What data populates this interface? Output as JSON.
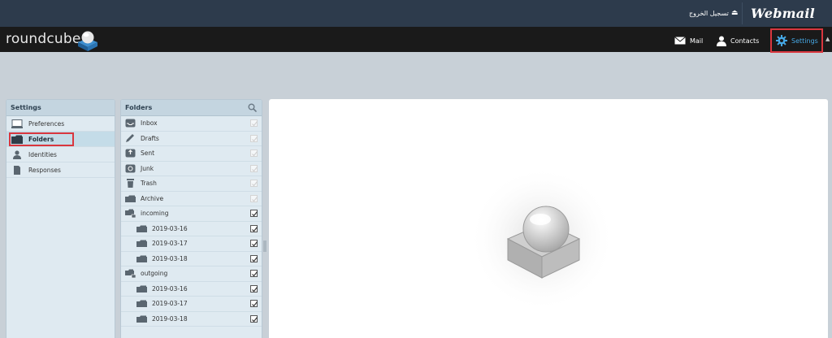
{
  "topbar": {
    "logout_label": "تسجيل الخروج",
    "brand": "Webmail"
  },
  "header": {
    "logo_text": "roundcube",
    "nav": {
      "mail": "Mail",
      "contacts": "Contacts",
      "settings": "Settings"
    }
  },
  "settings_panel": {
    "title": "Settings",
    "items": [
      {
        "label": "Preferences",
        "icon": "monitor-icon"
      },
      {
        "label": "Folders",
        "icon": "folder-icon",
        "selected": true
      },
      {
        "label": "Identities",
        "icon": "person-icon"
      },
      {
        "label": "Responses",
        "icon": "document-icon"
      }
    ]
  },
  "folders_panel": {
    "title": "Folders",
    "folders": [
      {
        "name": "Inbox",
        "icon": "inbox-icon",
        "checked": false
      },
      {
        "name": "Drafts",
        "icon": "pencil-icon",
        "checked": false
      },
      {
        "name": "Sent",
        "icon": "sent-icon",
        "checked": false
      },
      {
        "name": "Junk",
        "icon": "junk-icon",
        "checked": false
      },
      {
        "name": "Trash",
        "icon": "trash-icon",
        "checked": false
      },
      {
        "name": "Archive",
        "icon": "folder-icon",
        "checked": false
      },
      {
        "name": "incoming",
        "icon": "folder-tree-icon",
        "checked": true
      },
      {
        "name": "2019-03-16",
        "icon": "folder-icon",
        "checked": true,
        "sub": true
      },
      {
        "name": "2019-03-17",
        "icon": "folder-icon",
        "checked": true,
        "sub": true
      },
      {
        "name": "2019-03-18",
        "icon": "folder-icon",
        "checked": true,
        "sub": true
      },
      {
        "name": "outgoing",
        "icon": "folder-tree-icon",
        "checked": true
      },
      {
        "name": "2019-03-16",
        "icon": "folder-icon",
        "checked": true,
        "sub": true
      },
      {
        "name": "2019-03-17",
        "icon": "folder-icon",
        "checked": true,
        "sub": true
      },
      {
        "name": "2019-03-18",
        "icon": "folder-icon",
        "checked": true,
        "sub": true
      }
    ]
  },
  "colors": {
    "accent": "#46a8e5",
    "highlight": "#d9363e",
    "header_bg": "#1a1a1a",
    "topbar_bg": "#2d3b4c"
  }
}
